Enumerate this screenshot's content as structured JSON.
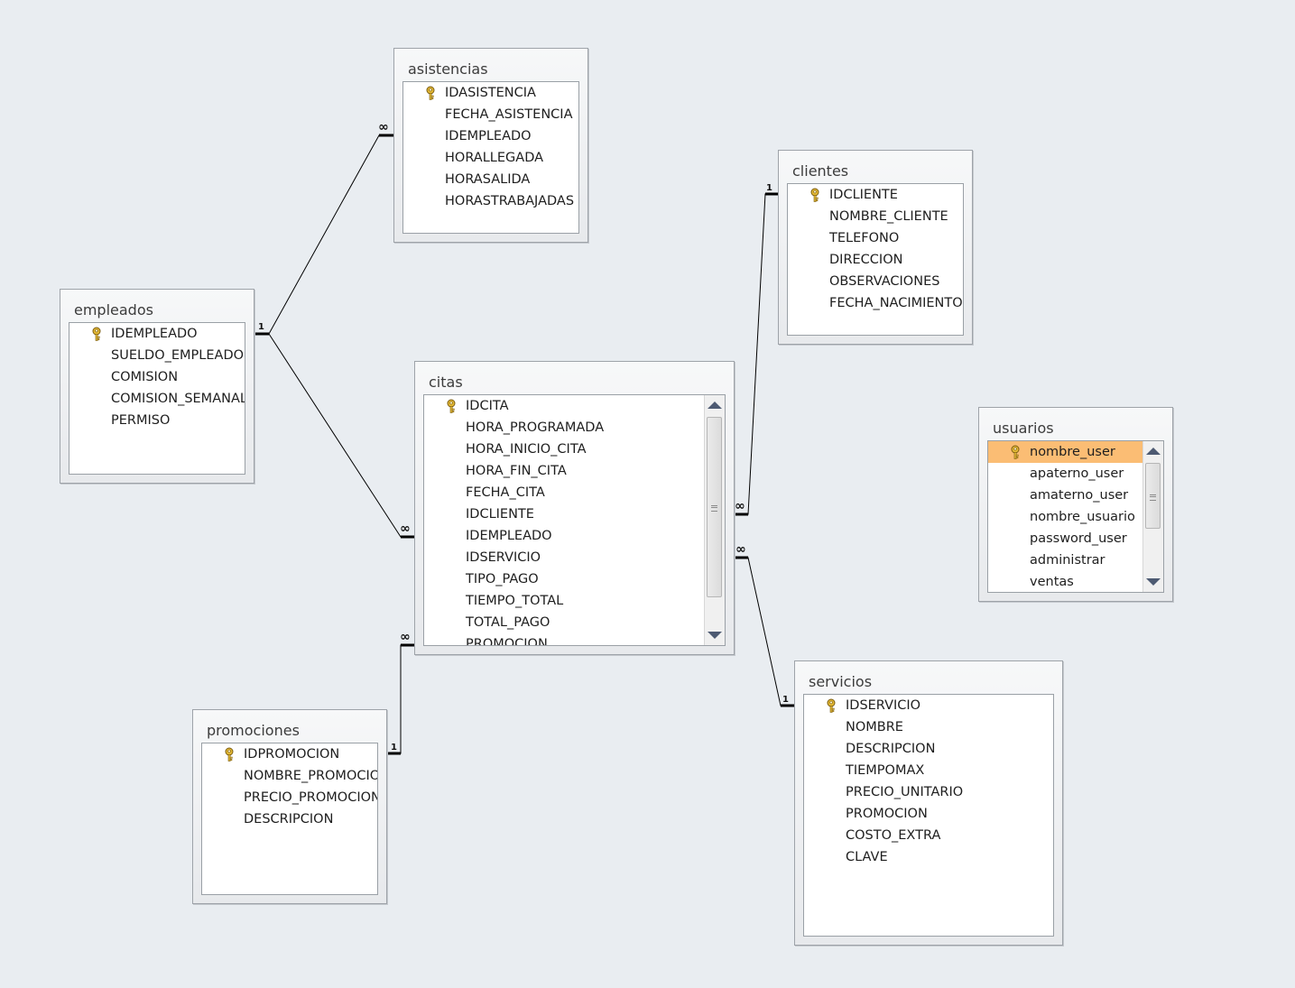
{
  "tables": {
    "asistencias": {
      "title": "asistencias",
      "fields": [
        "IDASISTENCIA",
        "FECHA_ASISTENCIA",
        "IDEMPLEADO",
        "HORALLEGADA",
        "HORASALIDA",
        "HORASTRABAJADAS"
      ]
    },
    "clientes": {
      "title": "clientes",
      "fields": [
        "IDCLIENTE",
        "NOMBRE_CLIENTE",
        "TELEFONO",
        "DIRECCION",
        "OBSERVACIONES",
        "FECHA_NACIMIENTO"
      ]
    },
    "empleados": {
      "title": "empleados",
      "fields": [
        "IDEMPLEADO",
        "SUELDO_EMPLEADO",
        "COMISION",
        "COMISION_SEMANAL",
        "PERMISO"
      ]
    },
    "citas": {
      "title": "citas",
      "fields": [
        "IDCITA",
        "HORA_PROGRAMADA",
        "HORA_INICIO_CITA",
        "HORA_FIN_CITA",
        "FECHA_CITA",
        "IDCLIENTE",
        "IDEMPLEADO",
        "IDSERVICIO",
        "TIPO_PAGO",
        "TIEMPO_TOTAL",
        "TOTAL_PAGO",
        "PROMOCION"
      ]
    },
    "usuarios": {
      "title": "usuarios",
      "fields": [
        "nombre_user",
        "apaterno_user",
        "amaterno_user",
        "nombre_usuario",
        "password_user",
        "administrar",
        "ventas"
      ]
    },
    "promociones": {
      "title": "promociones",
      "fields": [
        "IDPROMOCION",
        "NOMBRE_PROMOCION",
        "PRECIO_PROMOCION",
        "DESCRIPCION"
      ]
    },
    "servicios": {
      "title": "servicios",
      "fields": [
        "IDSERVICIO",
        "NOMBRE",
        "DESCRIPCION",
        "TIEMPOMAX",
        "PRECIO_UNITARIO",
        "PROMOCION",
        "COSTO_EXTRA",
        "CLAVE"
      ]
    }
  },
  "cardinality": {
    "one": "1",
    "many": "∞"
  },
  "colors": {
    "background": "#e9edf1",
    "selected": "#fbbd74",
    "line": "#000000"
  }
}
